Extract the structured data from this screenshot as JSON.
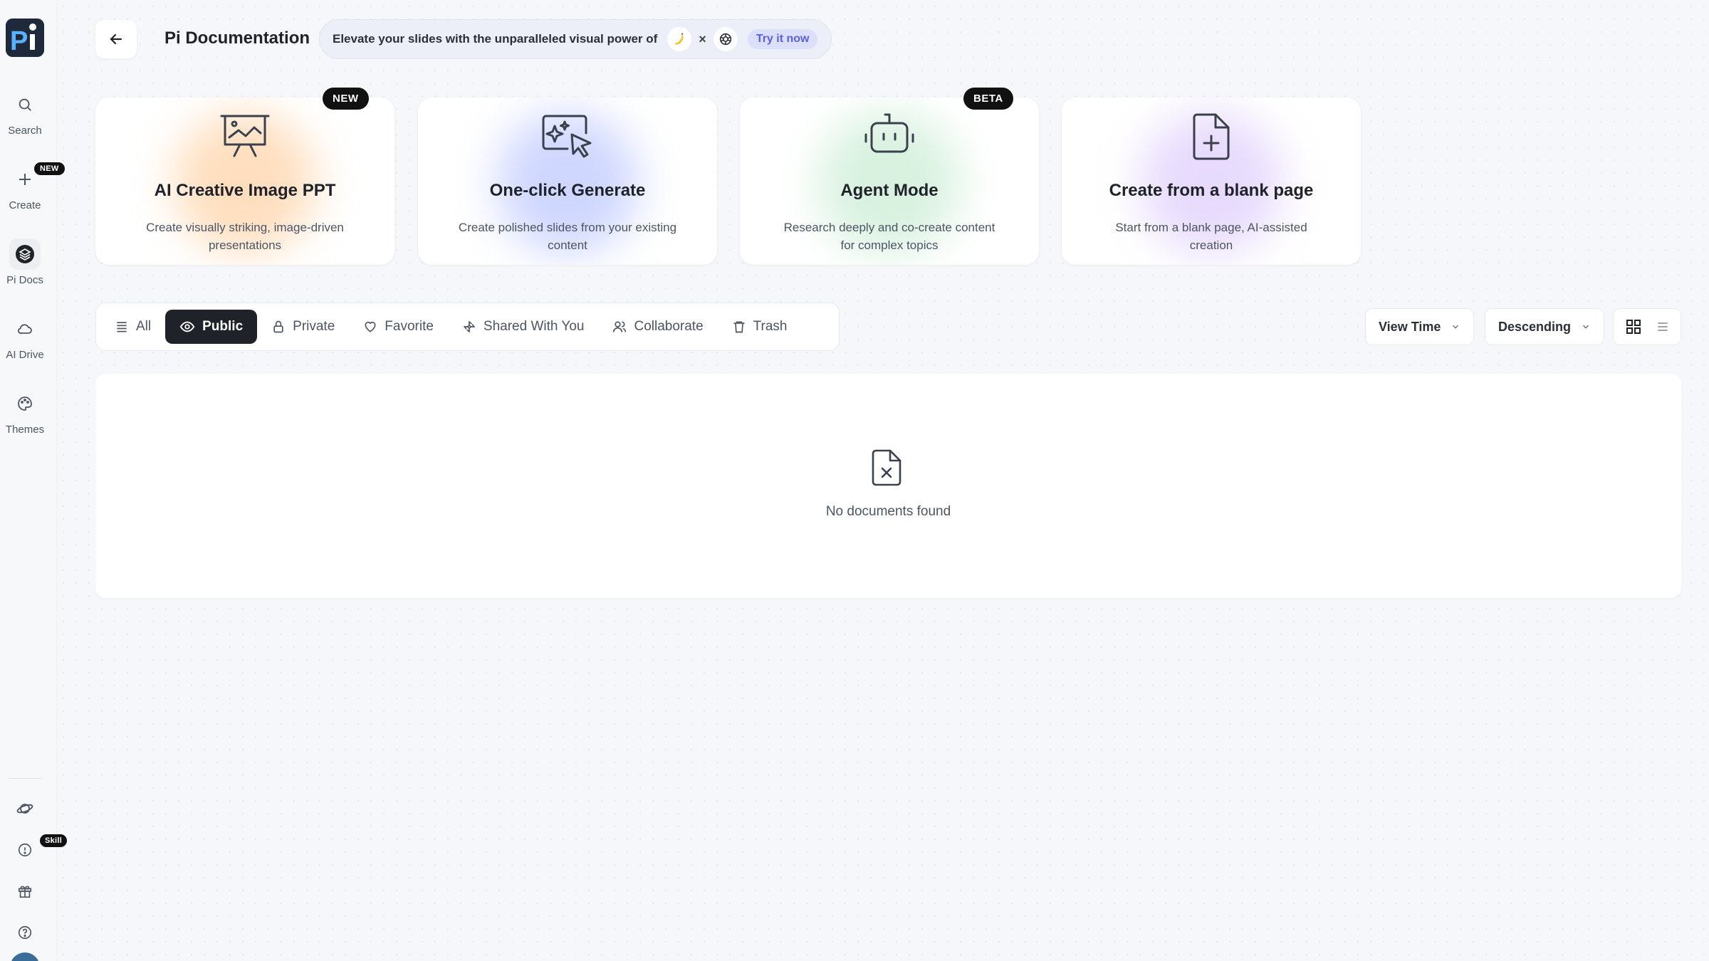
{
  "app": {
    "logo_alt": "Pi"
  },
  "sidebar": {
    "items": [
      {
        "label": "Search",
        "icon": "search-icon"
      },
      {
        "label": "Create",
        "icon": "plus-icon",
        "badge": "NEW"
      },
      {
        "label": "Pi Docs",
        "icon": "layers-icon"
      },
      {
        "label": "AI Drive",
        "icon": "cloud-icon"
      },
      {
        "label": "Themes",
        "icon": "palette-icon"
      }
    ],
    "bottom": [
      {
        "icon": "planet-icon"
      },
      {
        "icon": "skill-icon",
        "badge": "Skill"
      },
      {
        "icon": "gift-icon"
      },
      {
        "icon": "help-icon"
      }
    ]
  },
  "header": {
    "title": "Pi Documentation",
    "promo_text": "Elevate your slides with the unparalleled visual power of",
    "promo_times": "×",
    "promo_cta": "Try it now"
  },
  "cards": [
    {
      "title": "AI Creative Image PPT",
      "desc": "Create visually striking, image-driven presentations",
      "badge": "NEW",
      "glow": "#ffc48a"
    },
    {
      "title": "One-click Generate",
      "desc": "Create polished slides from your existing content",
      "glow": "#a9b6ff"
    },
    {
      "title": "Agent Mode",
      "desc": "Research deeply and co-create content for complex topics",
      "badge": "BETA",
      "glow": "#b9e6c6"
    },
    {
      "title": "Create from a blank page",
      "desc": "Start from a blank page, AI-assisted creation",
      "glow": "#d4bdfb"
    }
  ],
  "tabs": [
    {
      "label": "All",
      "icon": "list-icon",
      "active": false
    },
    {
      "label": "Public",
      "icon": "eye-icon",
      "active": true
    },
    {
      "label": "Private",
      "icon": "lock-icon",
      "active": false
    },
    {
      "label": "Favorite",
      "icon": "heart-icon",
      "active": false
    },
    {
      "label": "Shared With You",
      "icon": "share-icon",
      "active": false
    },
    {
      "label": "Collaborate",
      "icon": "users-icon",
      "active": false
    },
    {
      "label": "Trash",
      "icon": "trash-icon",
      "active": false
    }
  ],
  "sort": {
    "field": "View Time",
    "order": "Descending",
    "view_mode": "grid"
  },
  "content": {
    "empty_message": "No documents found"
  },
  "colors": {
    "active_tab_bg": "#1f2329",
    "promo_cta": "#5b5fe0",
    "badge_bg": "#111111"
  }
}
